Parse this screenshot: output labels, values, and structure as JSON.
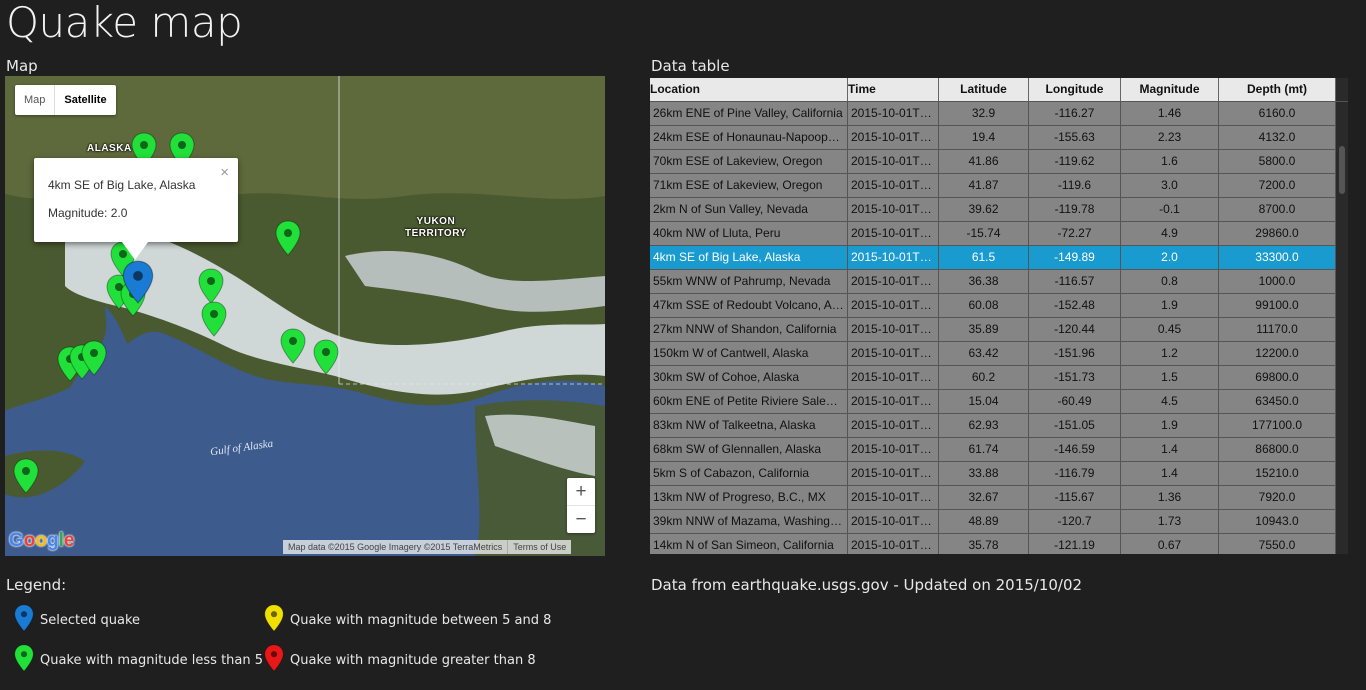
{
  "app_title": "Quake map",
  "map_section_label": "Map",
  "table_section_label": "Data table",
  "map": {
    "type_buttons": [
      "Map",
      "Satellite"
    ],
    "active_type": "Satellite",
    "place_labels": {
      "alaska": "ALASKA",
      "yukon": "YUKON\nTERRITORY",
      "gulf": "Gulf of Alaska"
    },
    "info_window": {
      "title": "4km SE of Big Lake, Alaska",
      "magnitude": "Magnitude: 2.0",
      "close_glyph": "×"
    },
    "zoom_in": "+",
    "zoom_out": "−",
    "logo": "Google",
    "attribution": "Map data ©2015 Google Imagery ©2015 TerraMetrics",
    "terms": "Terms of Use"
  },
  "table": {
    "columns": [
      "Location",
      "Time",
      "Latitude",
      "Longitude",
      "Magnitude",
      "Depth (mt)"
    ],
    "selected_index": 6,
    "rows": [
      [
        "26km ENE of Pine Valley, California",
        "2015-10-01T2…",
        "32.9",
        "-116.27",
        "1.46",
        "6160.0"
      ],
      [
        "24km ESE of Honaunau-Napoopo…",
        "2015-10-01T2…",
        "19.4",
        "-155.63",
        "2.23",
        "4132.0"
      ],
      [
        "70km ESE of Lakeview, Oregon",
        "2015-10-01T2…",
        "41.86",
        "-119.62",
        "1.6",
        "5800.0"
      ],
      [
        "71km ESE of Lakeview, Oregon",
        "2015-10-01T2…",
        "41.87",
        "-119.6",
        "3.0",
        "7200.0"
      ],
      [
        "2km N of Sun Valley, Nevada",
        "2015-10-01T1…",
        "39.62",
        "-119.78",
        "-0.1",
        "8700.0"
      ],
      [
        "40km NW of Lluta, Peru",
        "2015-10-01T1…",
        "-15.74",
        "-72.27",
        "4.9",
        "29860.0"
      ],
      [
        "4km SE of Big Lake, Alaska",
        "2015-10-01T1…",
        "61.5",
        "-149.89",
        "2.0",
        "33300.0"
      ],
      [
        "55km WNW of Pahrump, Nevada",
        "2015-10-01T1…",
        "36.38",
        "-116.57",
        "0.8",
        "1000.0"
      ],
      [
        "47km SSE of Redoubt Volcano, Al…",
        "2015-10-01T1…",
        "60.08",
        "-152.48",
        "1.9",
        "99100.0"
      ],
      [
        "27km NNW of Shandon, California",
        "2015-10-01T1…",
        "35.89",
        "-120.44",
        "0.45",
        "11170.0"
      ],
      [
        "150km W of Cantwell, Alaska",
        "2015-10-01T1…",
        "63.42",
        "-151.96",
        "1.2",
        "12200.0"
      ],
      [
        "30km SW of Cohoe, Alaska",
        "2015-10-01T1…",
        "60.2",
        "-151.73",
        "1.5",
        "69800.0"
      ],
      [
        "60km ENE of Petite Riviere Salee, …",
        "2015-10-01T1…",
        "15.04",
        "-60.49",
        "4.5",
        "63450.0"
      ],
      [
        "83km NW of Talkeetna, Alaska",
        "2015-10-01T1…",
        "62.93",
        "-151.05",
        "1.9",
        "177100.0"
      ],
      [
        "68km SW of Glennallen, Alaska",
        "2015-10-01T1…",
        "61.74",
        "-146.59",
        "1.4",
        "86800.0"
      ],
      [
        "5km S of Cabazon, California",
        "2015-10-01T1…",
        "33.88",
        "-116.79",
        "1.4",
        "15210.0"
      ],
      [
        "13km NW of Progreso, B.C., MX",
        "2015-10-01T1…",
        "32.67",
        "-115.67",
        "1.36",
        "7920.0"
      ],
      [
        "39km NNW of Mazama, Washingt…",
        "2015-10-01T1…",
        "48.89",
        "-120.7",
        "1.73",
        "10943.0"
      ],
      [
        "14km N of San Simeon, California",
        "2015-10-01T1…",
        "35.78",
        "-121.19",
        "0.67",
        "7550.0"
      ]
    ]
  },
  "source_note": "Data from earthquake.usgs.gov - Updated on 2015/10/02",
  "legend": {
    "title": "Legend:",
    "items": [
      {
        "label": "Selected quake",
        "color": "#1a7bd4",
        "icon": "blue-pin-icon"
      },
      {
        "label": "Quake with magnitude between 5 and 8",
        "color": "#f0e000",
        "icon": "yellow-pin-icon"
      },
      {
        "label": "Quake with magnitude less than 5",
        "color": "#22e03a",
        "icon": "green-pin-icon"
      },
      {
        "label": "Quake with magnitude greater than 8",
        "color": "#e81818",
        "icon": "red-pin-icon"
      }
    ]
  },
  "colors": {
    "background": "#1f1f1f",
    "selected_row": "#1a9bd0",
    "marker_green": "#22e03a",
    "marker_blue": "#1a7bd4"
  }
}
